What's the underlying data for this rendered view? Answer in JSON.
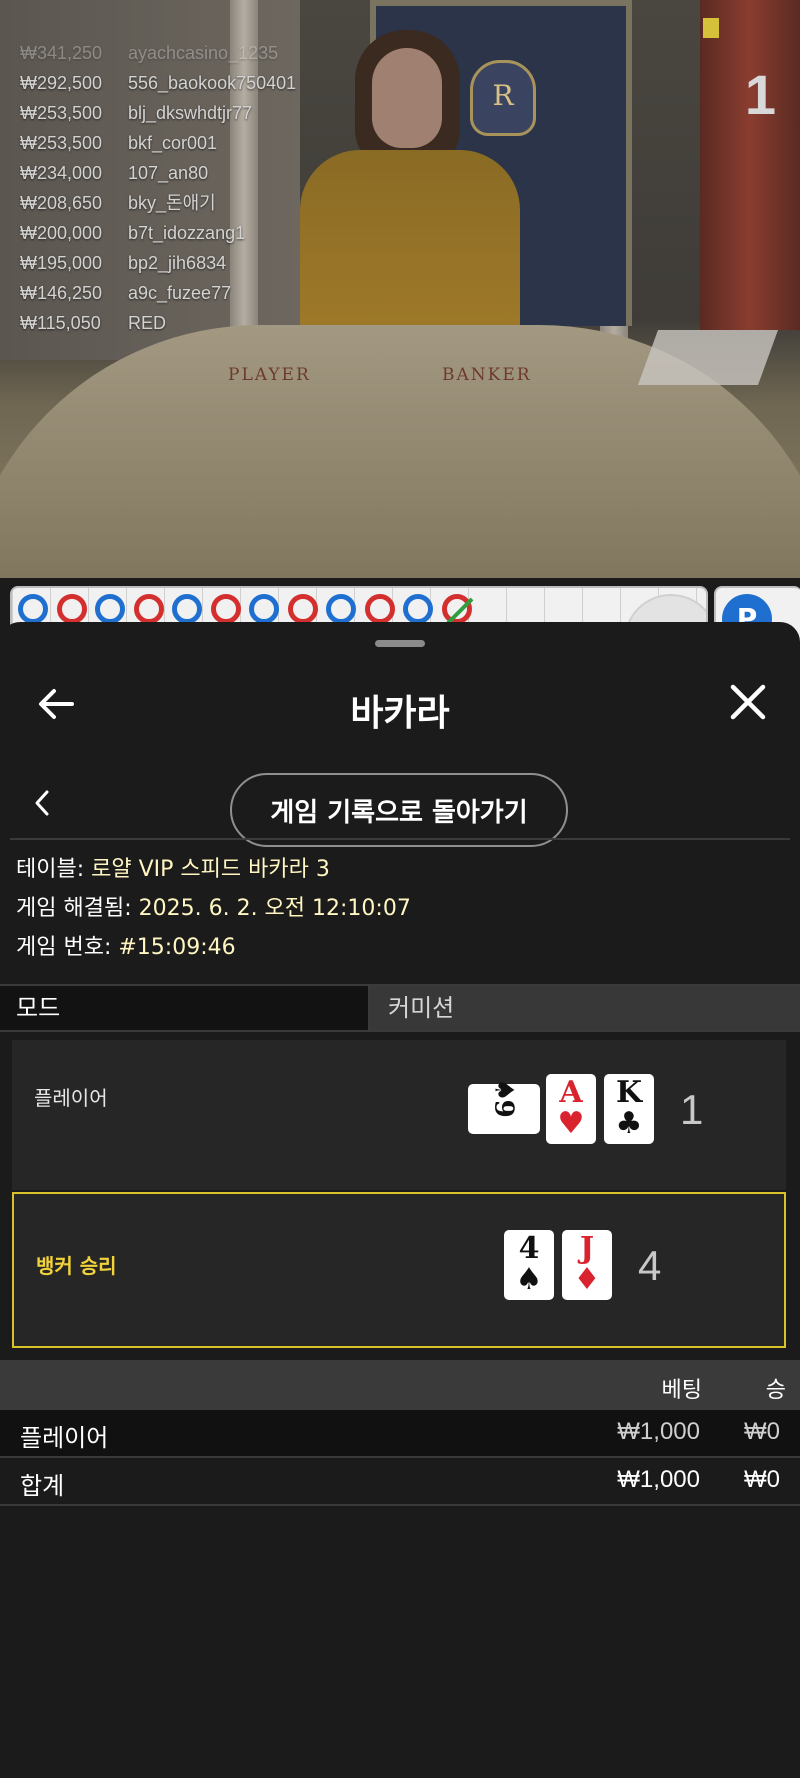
{
  "video": {
    "round_count": "1",
    "table_labels": {
      "player": "PLAYER",
      "banker": "BANKER"
    },
    "crest_letter": "R"
  },
  "leaderboard": [
    {
      "amount": "₩341,250",
      "name": "ayachcasino_1235"
    },
    {
      "amount": "₩292,500",
      "name": "556_baokook750401"
    },
    {
      "amount": "₩253,500",
      "name": "blj_dkswhdtjr77"
    },
    {
      "amount": "₩253,500",
      "name": "bkf_cor001"
    },
    {
      "amount": "₩234,000",
      "name": "107_an80"
    },
    {
      "amount": "₩208,650",
      "name": "bky_돈애기"
    },
    {
      "amount": "₩200,000",
      "name": "b7t_idozzang1"
    },
    {
      "amount": "₩195,000",
      "name": "bp2_jih6834"
    },
    {
      "amount": "₩146,250",
      "name": "a9c_fuzee77"
    },
    {
      "amount": "₩115,050",
      "name": "RED"
    }
  ],
  "road": {
    "beads": [
      "P",
      "B",
      "P",
      "B",
      "P",
      "B",
      "P",
      "B",
      "P",
      "B",
      "P",
      "B"
    ],
    "side_chip": "P",
    "colors": {
      "player": "#1f6fd1",
      "banker": "#d32f2f",
      "tie": "#2e9e3e"
    }
  },
  "sheet": {
    "title": "바카라",
    "back_icon": "arrow-left-icon",
    "close_icon": "close-icon",
    "return_button": "게임 기록으로 돌아가기",
    "meta": {
      "table_label": "테이블:",
      "table_value": "로얄 VIP 스피드 바카라 3",
      "resolved_label": "게임 해결됨:",
      "resolved_value": "2025. 6. 2. 오전 12:10:07",
      "number_label": "게임 번호:",
      "number_value": "#15:09:46"
    },
    "mode_header": {
      "mode": "모드",
      "commission": "커미션"
    },
    "hands": {
      "player": {
        "label": "플레이어",
        "cards": [
          {
            "rank": "9",
            "suit": "♠",
            "color": "black",
            "sideways": true
          },
          {
            "rank": "A",
            "suit": "♥",
            "color": "red"
          },
          {
            "rank": "K",
            "suit": "♣",
            "color": "black"
          }
        ],
        "score": "1"
      },
      "banker": {
        "label": "뱅커 승리",
        "cards": [
          {
            "rank": "4",
            "suit": "♠",
            "color": "black"
          },
          {
            "rank": "J",
            "suit": "♦",
            "color": "red"
          }
        ],
        "score": "4",
        "highlight_color": "#d9c12a"
      }
    },
    "bets": {
      "headers": {
        "bet": "베팅",
        "win": "승"
      },
      "rows": [
        {
          "name": "플레이어",
          "bet": "₩1,000",
          "win": "₩0"
        }
      ],
      "total": {
        "name": "합계",
        "bet": "₩1,000",
        "win": "₩0"
      }
    }
  }
}
